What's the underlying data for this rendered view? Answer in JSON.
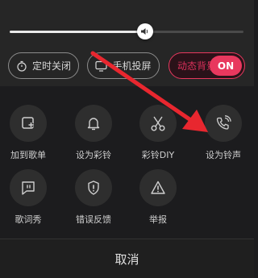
{
  "progress": {
    "value": 0.58
  },
  "pills": {
    "timer": {
      "label": "定时关闭",
      "icon": "timer-icon"
    },
    "cast": {
      "label": "手机投屏",
      "icon": "cast-screen-icon"
    },
    "dynamic_bg": {
      "label": "动态背景",
      "toggle": "ON"
    }
  },
  "actions": [
    {
      "label": "加到歌单",
      "icon": "add-to-playlist-icon"
    },
    {
      "label": "设为彩铃",
      "icon": "bell-icon"
    },
    {
      "label": "彩铃DIY",
      "icon": "scissors-icon"
    },
    {
      "label": "设为铃声",
      "icon": "phone-ring-icon"
    },
    {
      "label": "歌词秀",
      "icon": "lyrics-icon"
    },
    {
      "label": "错误反馈",
      "icon": "shield-alert-icon"
    },
    {
      "label": "举报",
      "icon": "warning-triangle-icon"
    }
  ],
  "footer": {
    "cancel_label": "取消"
  },
  "colors": {
    "accent": "#e8385e",
    "annotation_arrow": "#e8272f"
  }
}
